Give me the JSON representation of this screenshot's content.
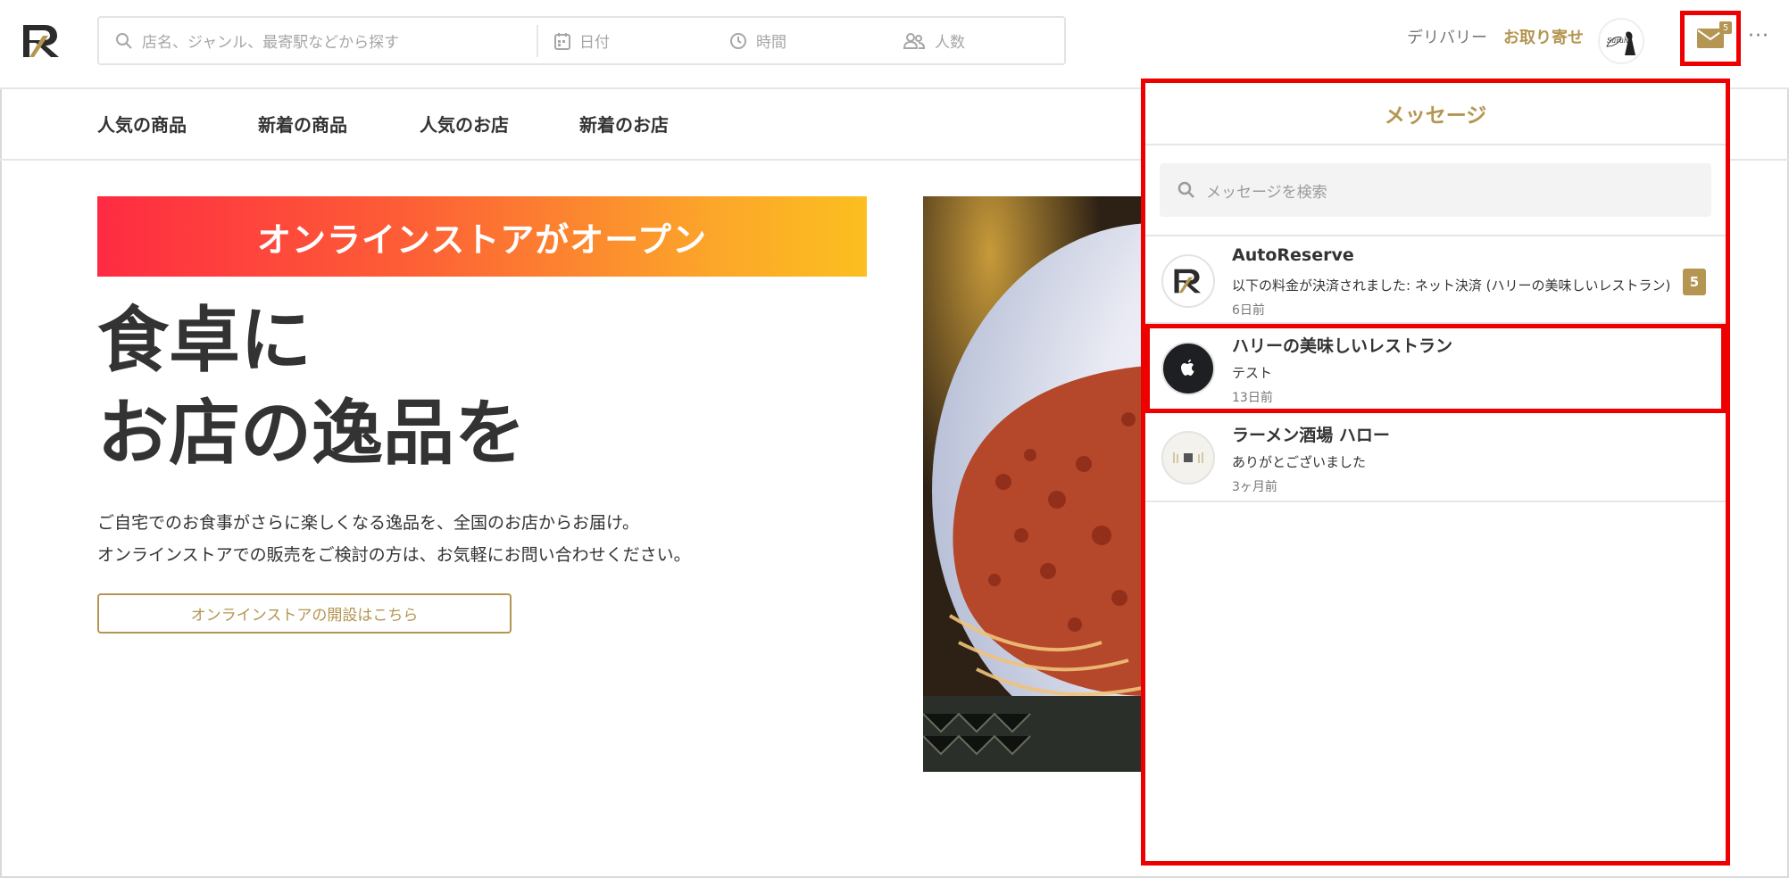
{
  "header": {
    "search_placeholder": "店名、ジャンル、最寄駅などから探す",
    "date_label": "日付",
    "time_label": "時間",
    "people_label": "人数",
    "delivery_link": "デリバリー",
    "order_link": "お取り寄せ",
    "mail_badge": "5",
    "more_label": "···"
  },
  "categories": [
    "人気の商品",
    "新着の商品",
    "人気のお店",
    "新着のお店"
  ],
  "hero": {
    "banner": "オンラインストアがオープン",
    "title_line1": "食卓に",
    "title_line2": "お店の逸品を",
    "desc_line1": "ご自宅でのお食事がさらに楽しくなる逸品を、全国のお店からお届け。",
    "desc_line2": "オンラインストアでの販売をご検討の方は、お気軽にお問い合わせください。",
    "cta": "オンラインストアの開設はこちら"
  },
  "messages": {
    "title": "メッセージ",
    "search_placeholder": "メッセージを検索",
    "items": [
      {
        "name": "AutoReserve",
        "preview": "以下の料金が決済されました: ネット決済 (ハリーの美味しいレストラン):",
        "time": "6日前",
        "unread": "5"
      },
      {
        "name": "ハリーの美味しいレストラン",
        "preview": "テスト",
        "time": "13日前"
      },
      {
        "name": "ラーメン酒場 ハロー",
        "preview": "ありがとございました",
        "time": "3ヶ月前"
      }
    ]
  },
  "colors": {
    "accent": "#b49552",
    "highlight": "#ee0000",
    "banner_start": "#fe2b42",
    "banner_end": "#fbbf1f"
  }
}
